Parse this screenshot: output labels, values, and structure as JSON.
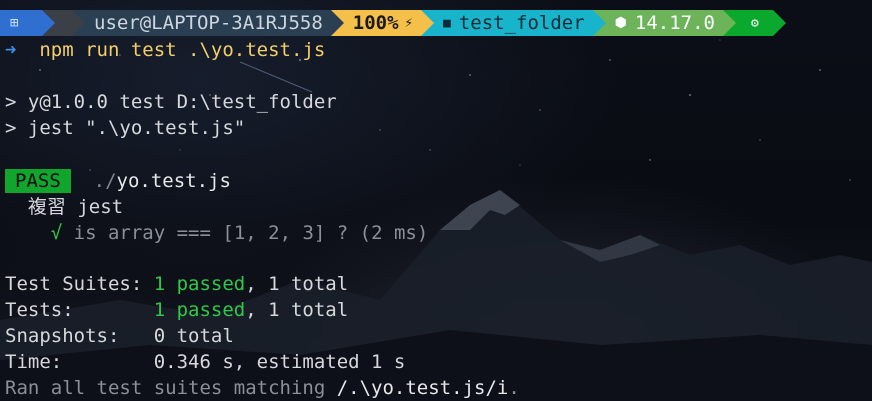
{
  "prompt": {
    "user_host": "user@LAPTOP-3A1RJ558",
    "battery": "100%",
    "battery_icon": "⚡",
    "folder_icon": "■",
    "folder": "test_folder",
    "node_icon": "⬢",
    "node_version": "14.17.0",
    "exit_icon": "⚙"
  },
  "command": {
    "arrow": "➜",
    "text": "npm run test .\\yo.test.js"
  },
  "output": {
    "script_header_1": "> y@1.0.0 test D:\\test_folder",
    "script_header_2": "> jest \".\\yo.test.js\"",
    "pass_badge": "PASS",
    "test_file_dir": "./",
    "test_file_name": "yo.test.js",
    "describe_block": "複習 jest",
    "check_mark": "√",
    "test_case": "is array === [1, 2, 3] ? (2 ms)",
    "summary": {
      "suites_label": "Test Suites: ",
      "suites_passed": "1 passed",
      "suites_total": ", 1 total",
      "tests_label": "Tests:       ",
      "tests_passed": "1 passed",
      "tests_total": ", 1 total",
      "snapshots_label": "Snapshots:   ",
      "snapshots_value": "0 total",
      "time_label": "Time:        ",
      "time_value": "0.346 s, estimated 1 s",
      "ran_prefix": "Ran all test suites matching ",
      "ran_pattern": "/.\\yo.test.js/i",
      "ran_suffix": "."
    }
  },
  "colors": {
    "background": "#07090f",
    "pass_green": "#11a52d",
    "passed_text": "#2fc94a",
    "command_yellow": "#f4ce6a",
    "arrow_blue": "#3d8ee6"
  }
}
